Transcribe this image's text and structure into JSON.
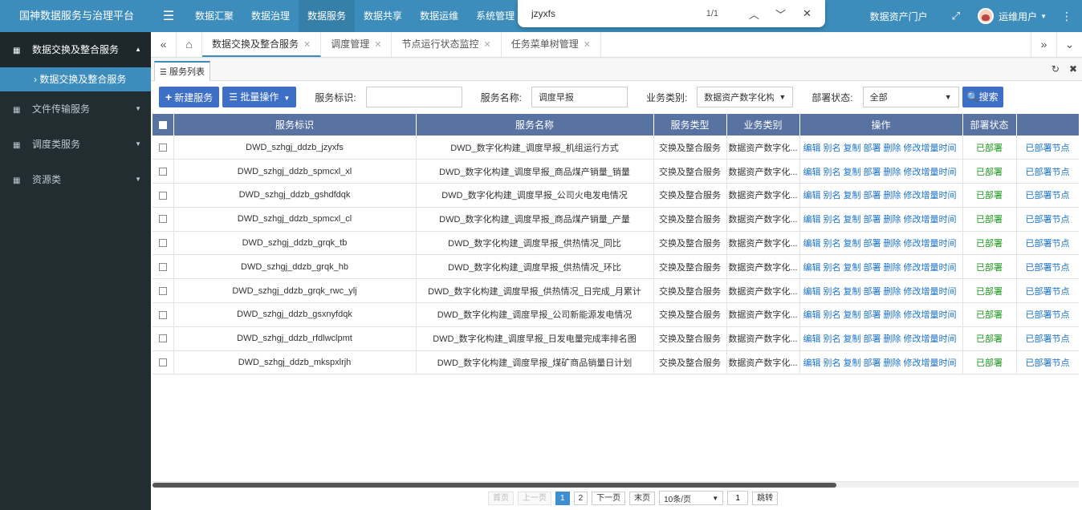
{
  "app": {
    "title": "国神数据服务与治理平台",
    "top_nav": [
      "数据汇聚",
      "数据治理",
      "数据服务",
      "数据共享",
      "数据运维",
      "系统管理"
    ],
    "active_nav_index": 2,
    "portal_label": "数据资产门户",
    "user_name": "运维用户",
    "accent_color": "#3c8dbc"
  },
  "find": {
    "query": "jzyxfs",
    "count": "1/1"
  },
  "sidebar": {
    "groups": [
      {
        "label": "数据交换及整合服务",
        "open": true
      },
      {
        "label": "文件传输服务",
        "open": false
      },
      {
        "label": "调度类服务",
        "open": false
      },
      {
        "label": "资源类",
        "open": false
      }
    ],
    "active_sub": "数据交换及整合服务"
  },
  "tabs": [
    {
      "label": "数据交换及整合服务",
      "active": true
    },
    {
      "label": "调度管理",
      "active": false
    },
    {
      "label": "节点运行状态监控",
      "active": false
    },
    {
      "label": "任务菜单树管理",
      "active": false
    }
  ],
  "panel": {
    "tab_label": "服务列表"
  },
  "toolbar": {
    "new_label": "新建服务",
    "batch_label": "批量操作",
    "service_id_label": "服务标识:",
    "service_id_value": "",
    "service_name_label": "服务名称:",
    "service_name_value": "调度早报",
    "business_label": "业务类别:",
    "business_value": "数据资产数字化构建",
    "deploy_label": "部署状态:",
    "deploy_value": "全部",
    "search_label": "搜索"
  },
  "table": {
    "headers": [
      "服务标识",
      "服务名称",
      "服务类型",
      "业务类别",
      "操作",
      "部署状态",
      ""
    ],
    "ops": [
      "编辑",
      "别名",
      "复制",
      "部署",
      "删除",
      "修改增量时间"
    ],
    "rows": [
      {
        "id": "DWD_szhgj_ddzb_jzyxfs",
        "name": "DWD_数字化构建_调度早报_机组运行方式",
        "type": "交换及整合服务",
        "biz": "数据资产数字化...",
        "status": "已部署",
        "extra": "已部署节点"
      },
      {
        "id": "DWD_szhgj_ddzb_spmcxl_xl",
        "name": "DWD_数字化构建_调度早报_商品煤产销量_销量",
        "type": "交换及整合服务",
        "biz": "数据资产数字化...",
        "status": "已部署",
        "extra": "已部署节点"
      },
      {
        "id": "DWD_szhgj_ddzb_gshdfdqk",
        "name": "DWD_数字化构建_调度早报_公司火电发电情况",
        "type": "交换及整合服务",
        "biz": "数据资产数字化...",
        "status": "已部署",
        "extra": "已部署节点"
      },
      {
        "id": "DWD_szhgj_ddzb_spmcxl_cl",
        "name": "DWD_数字化构建_调度早报_商品煤产销量_产量",
        "type": "交换及整合服务",
        "biz": "数据资产数字化...",
        "status": "已部署",
        "extra": "已部署节点"
      },
      {
        "id": "DWD_szhgj_ddzb_grqk_tb",
        "name": "DWD_数字化构建_调度早报_供热情况_同比",
        "type": "交换及整合服务",
        "biz": "数据资产数字化...",
        "status": "已部署",
        "extra": "已部署节点"
      },
      {
        "id": "DWD_szhgj_ddzb_grqk_hb",
        "name": "DWD_数字化构建_调度早报_供热情况_环比",
        "type": "交换及整合服务",
        "biz": "数据资产数字化...",
        "status": "已部署",
        "extra": "已部署节点"
      },
      {
        "id": "DWD_szhgj_ddzb_grqk_rwc_ylj",
        "name": "DWD_数字化构建_调度早报_供热情况_日完成_月累计",
        "type": "交换及整合服务",
        "biz": "数据资产数字化...",
        "status": "已部署",
        "extra": "已部署节点"
      },
      {
        "id": "DWD_szhgj_ddzb_gsxnyfdqk",
        "name": "DWD_数字化构建_调度早报_公司新能源发电情况",
        "type": "交换及整合服务",
        "biz": "数据资产数字化...",
        "status": "已部署",
        "extra": "已部署节点"
      },
      {
        "id": "DWD_szhgj_ddzb_rfdlwclpmt",
        "name": "DWD_数字化构建_调度早报_日发电量完成率排名图",
        "type": "交换及整合服务",
        "biz": "数据资产数字化...",
        "status": "已部署",
        "extra": "已部署节点"
      },
      {
        "id": "DWD_szhgj_ddzb_mkspxlrjh",
        "name": "DWD_数字化构建_调度早报_煤矿商品销量日计划",
        "type": "交换及整合服务",
        "biz": "数据资产数字化...",
        "status": "已部署",
        "extra": "已部署节点"
      }
    ]
  },
  "pager": {
    "first": "首页",
    "prev": "上一页",
    "pages": [
      "1",
      "2"
    ],
    "current_page": "1",
    "next": "下一页",
    "last": "末页",
    "page_size": "10条/页",
    "jump_value": "1",
    "jump_label": "跳转"
  }
}
